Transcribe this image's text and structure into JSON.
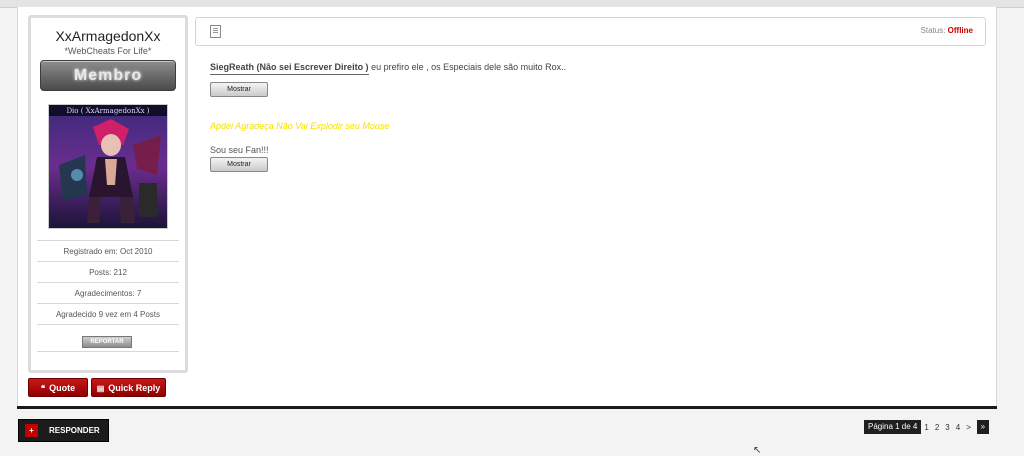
{
  "user": {
    "name": "XxArmagedonXx",
    "title": "*WebCheats For Life*",
    "rank": "Membro",
    "avatar_caption": "Dio ( XxArmagedonXx )",
    "registered": "Registrado em: Oct 2010",
    "posts": "Posts: 212",
    "thanks": "Agradecimentos: 7",
    "thanked": "Agradecido 9 vez em 4 Posts",
    "report_label": "REPORTAR"
  },
  "actions": {
    "quote_label": "Quote",
    "quick_reply_label": "Quick Reply"
  },
  "post": {
    "status_label": "Status:",
    "status_value": "Offline",
    "line1_bold": "SiegReath (Não sei Escrever Direito )",
    "line1_rest": " eu prefiro ele , os Especiais dele são muito Rox..",
    "show_label_1": "Mostrar",
    "yellow_text": "Apdei Agradeça Não Vai Explodir seu Mouse",
    "fan_text": "Sou seu Fan!!!",
    "show_label_2": "Mostrar"
  },
  "footer": {
    "reply_label": "RESPONDER",
    "page_label": "Página 1 de 4",
    "pages": [
      "1",
      "2",
      "3",
      "4"
    ],
    "next": ">",
    "last": "»"
  },
  "colors": {
    "accent_red": "#c81818",
    "status_offline": "#d00000",
    "signature_yellow": "#f5e100",
    "dark": "#1c1c1c"
  },
  "icons": {
    "quote": "quote-icon",
    "quick_reply": "quick-reply-icon",
    "post": "document-icon",
    "reply": "plus-icon"
  }
}
